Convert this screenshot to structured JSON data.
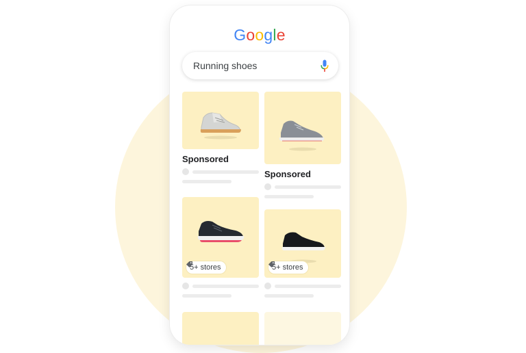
{
  "logo": {
    "letters": [
      "G",
      "o",
      "o",
      "g",
      "l",
      "e"
    ],
    "colors": [
      "#4285F4",
      "#EA4335",
      "#FBBC05",
      "#4285F4",
      "#34A853",
      "#EA4335"
    ]
  },
  "search": {
    "query": "Running shoes",
    "icon": "mic-icon"
  },
  "results": [
    {
      "label": "Sponsored",
      "shoe": "gray-tan-sneaker"
    },
    {
      "label": "Sponsored",
      "shoe": "gray-knit-runner"
    },
    {
      "badge": "5+ stores",
      "shoe": "black-red-runner"
    },
    {
      "badge": "5+ stores",
      "shoe": "black-slip-on"
    }
  ],
  "colors": {
    "card_bg": "#fdf0c2",
    "page_circle": "#fdf5dc",
    "text": "#202124"
  }
}
